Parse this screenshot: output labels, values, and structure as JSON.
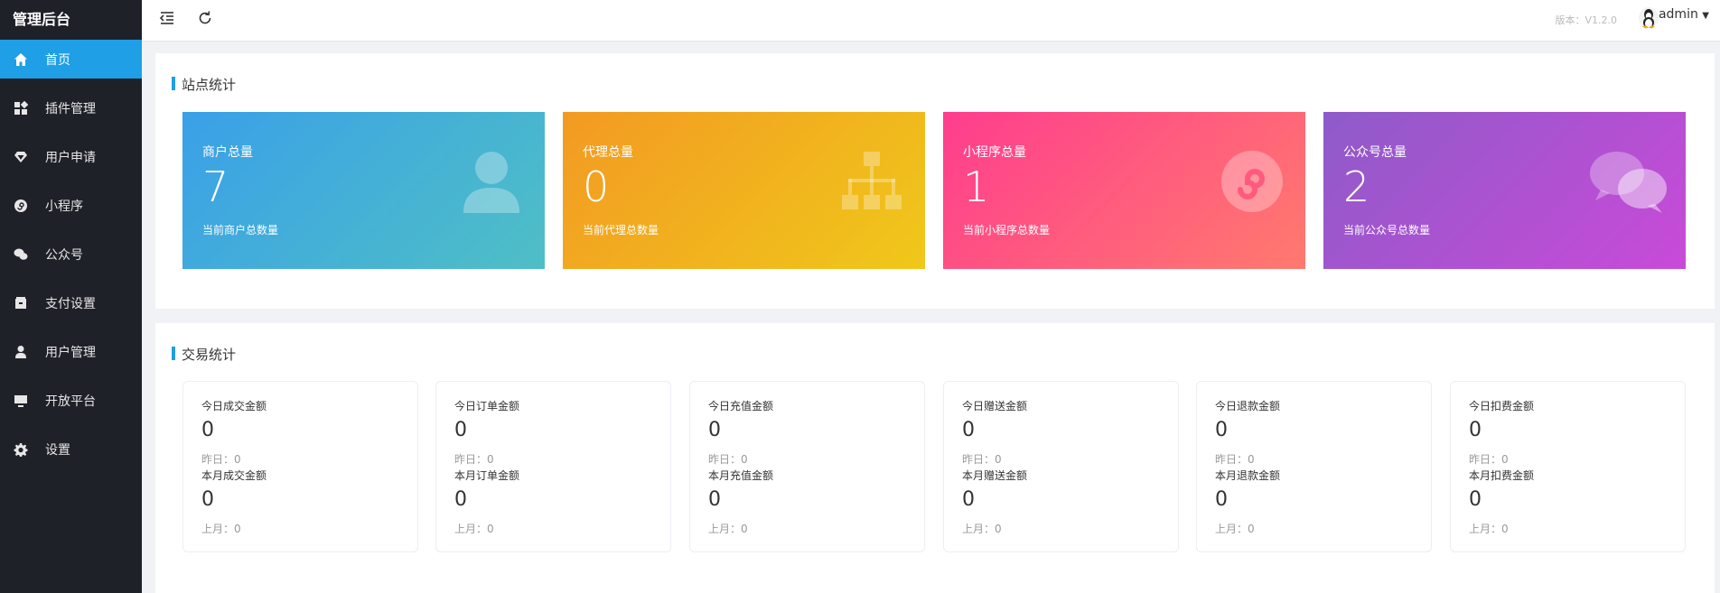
{
  "sidebar": {
    "brand": "管理后台",
    "items": [
      {
        "label": "首页",
        "icon": "home-icon",
        "active": true
      },
      {
        "label": "插件管理",
        "icon": "apps-icon",
        "active": false
      },
      {
        "label": "用户申请",
        "icon": "diamond-icon",
        "active": false
      },
      {
        "label": "小程序",
        "icon": "miniprogram-icon",
        "active": false
      },
      {
        "label": "公众号",
        "icon": "wechat-icon",
        "active": false
      },
      {
        "label": "支付设置",
        "icon": "wallet-icon",
        "active": false
      },
      {
        "label": "用户管理",
        "icon": "user-icon",
        "active": false
      },
      {
        "label": "开放平台",
        "icon": "monitor-icon",
        "active": false
      },
      {
        "label": "设置",
        "icon": "gear-icon",
        "active": false
      }
    ]
  },
  "header": {
    "version": "版本：V1.2.0",
    "username": "admin"
  },
  "site_stats": {
    "title": "站点统计",
    "cards": [
      {
        "label": "商户总量",
        "value": "7",
        "sub": "当前商户总数量",
        "icon": "user-icon",
        "gradient": [
          "#3aa0e8",
          "#4fbfc5"
        ]
      },
      {
        "label": "代理总量",
        "value": "0",
        "sub": "当前代理总数量",
        "icon": "org-chart-icon",
        "gradient": [
          "#f29a23",
          "#f0c81a"
        ]
      },
      {
        "label": "小程序总量",
        "value": "1",
        "sub": "当前小程序总数量",
        "icon": "miniprogram-icon",
        "gradient": [
          "#ff3d8e",
          "#ff7a6e"
        ]
      },
      {
        "label": "公众号总量",
        "value": "2",
        "sub": "当前公众号总数量",
        "icon": "wechat-icon",
        "gradient": [
          "#8e5bc9",
          "#c94ad8"
        ]
      }
    ]
  },
  "trade_stats": {
    "title": "交易统计",
    "cards": [
      {
        "today_label": "今日成交金额",
        "today_value": "0",
        "yesterday": "昨日：0",
        "month_label": "本月成交金额",
        "month_value": "0",
        "last_month": "上月：0"
      },
      {
        "today_label": "今日订单金额",
        "today_value": "0",
        "yesterday": "昨日：0",
        "month_label": "本月订单金额",
        "month_value": "0",
        "last_month": "上月：0"
      },
      {
        "today_label": "今日充值金额",
        "today_value": "0",
        "yesterday": "昨日：0",
        "month_label": "本月充值金额",
        "month_value": "0",
        "last_month": "上月：0"
      },
      {
        "today_label": "今日赠送金额",
        "today_value": "0",
        "yesterday": "昨日：0",
        "month_label": "本月赠送金额",
        "month_value": "0",
        "last_month": "上月：0"
      },
      {
        "today_label": "今日退款金额",
        "today_value": "0",
        "yesterday": "昨日：0",
        "month_label": "本月退款金额",
        "month_value": "0",
        "last_month": "上月：0"
      },
      {
        "today_label": "今日扣费金额",
        "today_value": "0",
        "yesterday": "昨日：0",
        "month_label": "本月扣费金额",
        "month_value": "0",
        "last_month": "上月：0"
      }
    ]
  }
}
